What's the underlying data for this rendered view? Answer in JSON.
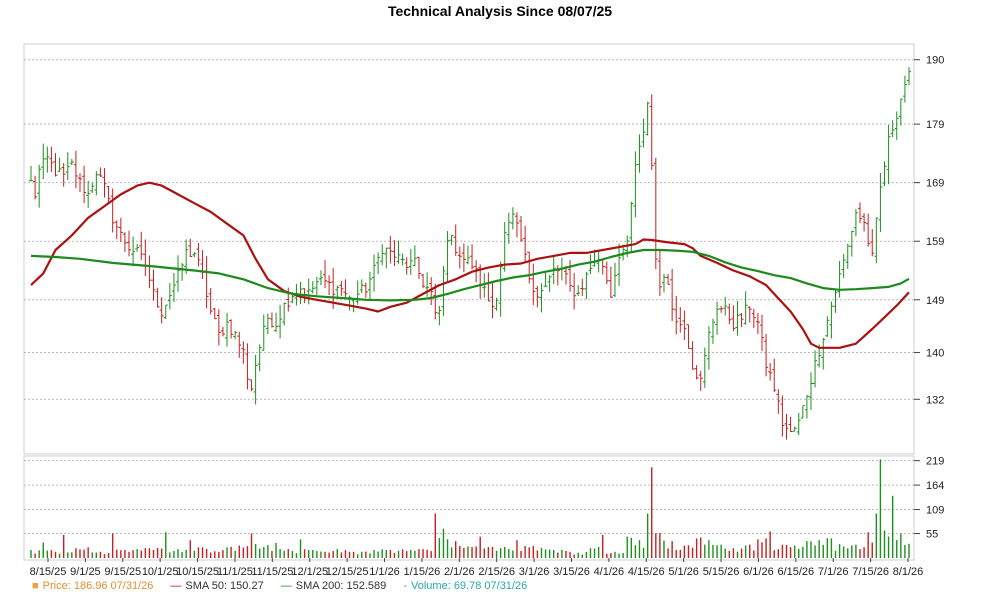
{
  "chart_data": {
    "type": "line",
    "title": "Technical Analysis Since 08/07/25",
    "price_axis": {
      "ticks": [
        132,
        140,
        149,
        159,
        169,
        179,
        190
      ],
      "ylim": [
        123,
        192
      ]
    },
    "volume_axis": {
      "ticks": [
        55,
        109,
        164,
        219
      ],
      "ylim": [
        0,
        225
      ]
    },
    "x_labels": [
      "8/15/25",
      "9/1/25",
      "9/15/25",
      "10/1/25",
      "10/15/25",
      "11/1/25",
      "11/15/25",
      "12/1/25",
      "12/15/25",
      "1/1/26",
      "1/15/26",
      "2/1/26",
      "2/15/26",
      "3/1/26",
      "3/15/26",
      "4/1/26",
      "4/15/26",
      "5/1/26",
      "5/15/26",
      "6/1/26",
      "6/15/26",
      "7/1/26",
      "7/15/26",
      "8/1/26"
    ],
    "grid": true,
    "price_anchors": [
      [
        0,
        169
      ],
      [
        1,
        167
      ],
      [
        2,
        171
      ],
      [
        4,
        173
      ],
      [
        6,
        171
      ],
      [
        8,
        170
      ],
      [
        10,
        172
      ],
      [
        12,
        169
      ],
      [
        14,
        167
      ],
      [
        16,
        171
      ],
      [
        18,
        168
      ],
      [
        20,
        163
      ],
      [
        22,
        160
      ],
      [
        24,
        158
      ],
      [
        26,
        157
      ],
      [
        28,
        155
      ],
      [
        30,
        150
      ],
      [
        32,
        147
      ],
      [
        34,
        150
      ],
      [
        36,
        153
      ],
      [
        38,
        157
      ],
      [
        40,
        157
      ],
      [
        42,
        153
      ],
      [
        44,
        147
      ],
      [
        46,
        143
      ],
      [
        48,
        145
      ],
      [
        50,
        143
      ],
      [
        52,
        140
      ],
      [
        53,
        136
      ],
      [
        54,
        134
      ],
      [
        55,
        138
      ],
      [
        56,
        141
      ],
      [
        58,
        146
      ],
      [
        60,
        145
      ],
      [
        62,
        148
      ],
      [
        64,
        150
      ],
      [
        66,
        151
      ],
      [
        68,
        150
      ],
      [
        70,
        152
      ],
      [
        72,
        152
      ],
      [
        74,
        151
      ],
      [
        76,
        151
      ],
      [
        78,
        149
      ],
      [
        80,
        150
      ],
      [
        82,
        151
      ],
      [
        84,
        154
      ],
      [
        86,
        158
      ],
      [
        88,
        157
      ],
      [
        90,
        156
      ],
      [
        92,
        155
      ],
      [
        94,
        155
      ],
      [
        96,
        152
      ],
      [
        98,
        150
      ],
      [
        99,
        146
      ],
      [
        100,
        147
      ],
      [
        102,
        160
      ],
      [
        104,
        158
      ],
      [
        106,
        156
      ],
      [
        108,
        155
      ],
      [
        110,
        152
      ],
      [
        112,
        149
      ],
      [
        113,
        148
      ],
      [
        114,
        150
      ],
      [
        116,
        160
      ],
      [
        118,
        163
      ],
      [
        120,
        159
      ],
      [
        122,
        153
      ],
      [
        124,
        150
      ],
      [
        126,
        151
      ],
      [
        128,
        154
      ],
      [
        130,
        154
      ],
      [
        132,
        151
      ],
      [
        134,
        150
      ],
      [
        136,
        153
      ],
      [
        138,
        156
      ],
      [
        140,
        155
      ],
      [
        142,
        150
      ],
      [
        144,
        157
      ],
      [
        146,
        158
      ],
      [
        148,
        172
      ],
      [
        150,
        177
      ],
      [
        151,
        183
      ],
      [
        152,
        172
      ],
      [
        153,
        156
      ],
      [
        154,
        152
      ],
      [
        156,
        152
      ],
      [
        158,
        145
      ],
      [
        160,
        145
      ],
      [
        162,
        138
      ],
      [
        164,
        135
      ],
      [
        166,
        143
      ],
      [
        168,
        148
      ],
      [
        170,
        147
      ],
      [
        172,
        145
      ],
      [
        174,
        146
      ],
      [
        176,
        148
      ],
      [
        178,
        145
      ],
      [
        180,
        138
      ],
      [
        182,
        134
      ],
      [
        184,
        128
      ],
      [
        186,
        126
      ],
      [
        188,
        128
      ],
      [
        190,
        133
      ],
      [
        192,
        138
      ],
      [
        194,
        143
      ],
      [
        196,
        148
      ],
      [
        198,
        153
      ],
      [
        200,
        158
      ],
      [
        202,
        164
      ],
      [
        204,
        162
      ],
      [
        206,
        156
      ],
      [
        208,
        168
      ],
      [
        210,
        176
      ],
      [
        212,
        181
      ],
      [
        214,
        186
      ],
      [
        215,
        187
      ]
    ],
    "series": [
      {
        "name": "SMA 50",
        "color": "#aa1111",
        "points": [
          [
            0,
            151.5
          ],
          [
            3,
            153.5
          ],
          [
            6,
            157.5
          ],
          [
            10,
            160
          ],
          [
            14,
            163
          ],
          [
            18,
            165
          ],
          [
            22,
            167
          ],
          [
            26,
            168.5
          ],
          [
            29,
            169
          ],
          [
            32,
            168.5
          ],
          [
            36,
            167
          ],
          [
            40,
            165.5
          ],
          [
            44,
            164
          ],
          [
            48,
            162
          ],
          [
            52,
            160
          ],
          [
            55,
            156
          ],
          [
            58,
            152.5
          ],
          [
            62,
            150.5
          ],
          [
            66,
            149.5
          ],
          [
            70,
            149
          ],
          [
            74,
            148.5
          ],
          [
            78,
            148
          ],
          [
            82,
            147.5
          ],
          [
            85,
            147
          ],
          [
            88,
            147.8
          ],
          [
            92,
            148.5
          ],
          [
            96,
            150
          ],
          [
            100,
            151.5
          ],
          [
            104,
            152.5
          ],
          [
            108,
            153.8
          ],
          [
            112,
            154.5
          ],
          [
            116,
            155
          ],
          [
            120,
            155.2
          ],
          [
            124,
            156
          ],
          [
            128,
            156.5
          ],
          [
            132,
            157
          ],
          [
            136,
            157
          ],
          [
            140,
            157.5
          ],
          [
            144,
            158
          ],
          [
            148,
            158.5
          ],
          [
            150,
            159.3
          ],
          [
            152,
            159.2
          ],
          [
            156,
            158.8
          ],
          [
            160,
            158.5
          ],
          [
            162,
            157.8
          ],
          [
            164,
            156.5
          ],
          [
            168,
            155.3
          ],
          [
            172,
            154
          ],
          [
            176,
            153
          ],
          [
            180,
            151.5
          ],
          [
            184,
            148.5
          ],
          [
            186,
            147
          ],
          [
            189,
            144
          ],
          [
            191,
            141.5
          ],
          [
            193,
            140.8
          ],
          [
            198,
            140.8
          ],
          [
            202,
            141.5
          ],
          [
            206,
            144
          ],
          [
            209,
            146
          ],
          [
            212,
            148
          ],
          [
            214,
            149.5
          ],
          [
            215,
            150.27
          ]
        ]
      },
      {
        "name": "SMA 200",
        "color": "#1c8a1c",
        "points": [
          [
            0,
            156.5
          ],
          [
            6,
            156.3
          ],
          [
            12,
            156
          ],
          [
            20,
            155.3
          ],
          [
            30,
            154.7
          ],
          [
            40,
            154
          ],
          [
            46,
            153.5
          ],
          [
            52,
            152.5
          ],
          [
            58,
            151
          ],
          [
            64,
            150
          ],
          [
            70,
            149.6
          ],
          [
            76,
            149.3
          ],
          [
            82,
            149
          ],
          [
            88,
            148.9
          ],
          [
            94,
            149
          ],
          [
            98,
            149.3
          ],
          [
            102,
            150
          ],
          [
            106,
            150.8
          ],
          [
            110,
            151.5
          ],
          [
            114,
            152.2
          ],
          [
            118,
            152.8
          ],
          [
            122,
            153.2
          ],
          [
            126,
            153.8
          ],
          [
            130,
            154.3
          ],
          [
            134,
            155
          ],
          [
            138,
            155.5
          ],
          [
            142,
            156.3
          ],
          [
            146,
            157
          ],
          [
            150,
            157.5
          ],
          [
            154,
            157.5
          ],
          [
            158,
            157.4
          ],
          [
            162,
            157.2
          ],
          [
            166,
            156.5
          ],
          [
            170,
            155.4
          ],
          [
            174,
            154.5
          ],
          [
            178,
            153.9
          ],
          [
            182,
            153.2
          ],
          [
            186,
            152.7
          ],
          [
            190,
            151.8
          ],
          [
            194,
            151
          ],
          [
            198,
            150.7
          ],
          [
            202,
            150.8
          ],
          [
            206,
            151
          ],
          [
            210,
            151.2
          ],
          [
            213,
            151.8
          ],
          [
            215,
            152.589
          ]
        ]
      }
    ],
    "volume_bars": [
      [
        0,
        18
      ],
      [
        3,
        35
      ],
      [
        6,
        14
      ],
      [
        8,
        52
      ],
      [
        11,
        22
      ],
      [
        14,
        24
      ],
      [
        17,
        14
      ],
      [
        20,
        55
      ],
      [
        23,
        18
      ],
      [
        26,
        20
      ],
      [
        30,
        18
      ],
      [
        33,
        58
      ],
      [
        36,
        20
      ],
      [
        39,
        40
      ],
      [
        42,
        24
      ],
      [
        45,
        15
      ],
      [
        48,
        24
      ],
      [
        51,
        28
      ],
      [
        54,
        55
      ],
      [
        57,
        25
      ],
      [
        60,
        34
      ],
      [
        63,
        20
      ],
      [
        66,
        42
      ],
      [
        69,
        18
      ],
      [
        72,
        14
      ],
      [
        75,
        20
      ],
      [
        78,
        14
      ],
      [
        81,
        14
      ],
      [
        84,
        18
      ],
      [
        87,
        18
      ],
      [
        90,
        16
      ],
      [
        93,
        18
      ],
      [
        96,
        20
      ],
      [
        99,
        100
      ],
      [
        101,
        66
      ],
      [
        104,
        38
      ],
      [
        107,
        26
      ],
      [
        110,
        48
      ],
      [
        113,
        25
      ],
      [
        116,
        25
      ],
      [
        119,
        40
      ],
      [
        122,
        24
      ],
      [
        125,
        23
      ],
      [
        128,
        18
      ],
      [
        131,
        16
      ],
      [
        134,
        12
      ],
      [
        137,
        22
      ],
      [
        140,
        52
      ],
      [
        143,
        14
      ],
      [
        146,
        48
      ],
      [
        149,
        40
      ],
      [
        151,
        100
      ],
      [
        152,
        204
      ],
      [
        154,
        56
      ],
      [
        157,
        38
      ],
      [
        160,
        28
      ],
      [
        163,
        44
      ],
      [
        166,
        40
      ],
      [
        169,
        30
      ],
      [
        172,
        22
      ],
      [
        175,
        28
      ],
      [
        178,
        42
      ],
      [
        181,
        60
      ],
      [
        184,
        30
      ],
      [
        187,
        28
      ],
      [
        190,
        38
      ],
      [
        193,
        40
      ],
      [
        196,
        44
      ],
      [
        199,
        26
      ],
      [
        202,
        30
      ],
      [
        205,
        58
      ],
      [
        207,
        100
      ],
      [
        208,
        222
      ],
      [
        209,
        62
      ],
      [
        211,
        140
      ],
      [
        213,
        55
      ],
      [
        215,
        32
      ]
    ],
    "volume_colors": {
      "up": "#1e8f1e",
      "down": "#c42020"
    },
    "n_points": 216
  },
  "legend": {
    "price": {
      "label": "Price:",
      "value": "186.96",
      "date": "07/31/26",
      "color": "#f0a040"
    },
    "sma50": {
      "label": "SMA 50:",
      "value": "150.27",
      "color": "#aa1111"
    },
    "sma200": {
      "label": "SMA 200:",
      "value": "152.589",
      "color": "#1c8a1c"
    },
    "volume": {
      "label": "Volume:",
      "value": "69.78",
      "date": "07/31/26",
      "color": "#2aa8a8"
    }
  }
}
